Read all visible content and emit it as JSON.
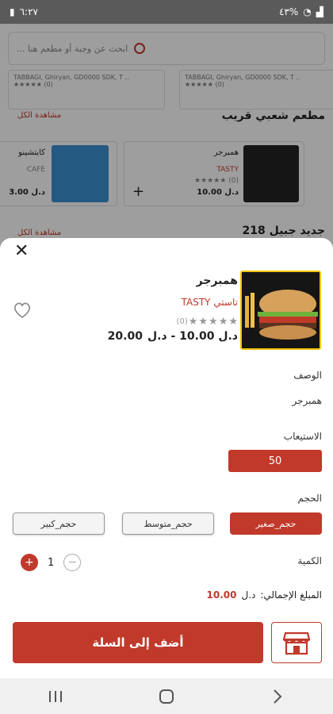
{
  "status_bar": {
    "time": "٦:٢٧",
    "battery": "٤٣%"
  },
  "background": {
    "search_placeholder": "ابحث عن وجبة أو مطعم هنا ...",
    "top_cards": [
      {
        "address": "TABBAGI, Ghiryan, GD0000 SDK, T ..",
        "reviews": "(0)"
      },
      {
        "address": "TABBAGI, Ghiryan, GD0000 SDK, T ..",
        "reviews": "(0)"
      }
    ],
    "section1_title": "مطعم شعبي قريب",
    "section1_see_all": "مشاهدة الكل",
    "card_a": {
      "name": "همبرجر",
      "shop": "TASTY",
      "reviews": "(0)",
      "price": "10.00",
      "currency": "د.ل"
    },
    "card_b": {
      "name": "كابتشينو",
      "shop": "CAFE",
      "price": "3.00",
      "currency": "د.ل"
    },
    "section2_title": "جديد جبيل 218",
    "section2_see_all": "مشاهدة الكل"
  },
  "product": {
    "name": "همبرجر",
    "shop_ar": "تاستي",
    "shop_en": "TASTY",
    "review_count": "(0)",
    "rating": 0,
    "price_range": "د.ل 10.00 - د.ل",
    "price_max": "20.00"
  },
  "details": {
    "description_label": "الوصف",
    "description_value": "همبرجر",
    "capacity_label": "الاستيعاب",
    "capacity_value": "50",
    "size_label": "الحجم",
    "sizes": [
      "حجم_صغير",
      "حجم_متوسط",
      "حجم_كبير"
    ],
    "selected_size_index": 0,
    "quantity_label": "الكمية",
    "quantity": "1",
    "total_label": "المبلغ الإجمالي:",
    "total_currency": "د.ل",
    "total_value": "10.00"
  },
  "actions": {
    "add_to_cart": "أضف إلى السلة"
  },
  "colors": {
    "accent": "#c0392b",
    "image_border": "#f3c300"
  }
}
